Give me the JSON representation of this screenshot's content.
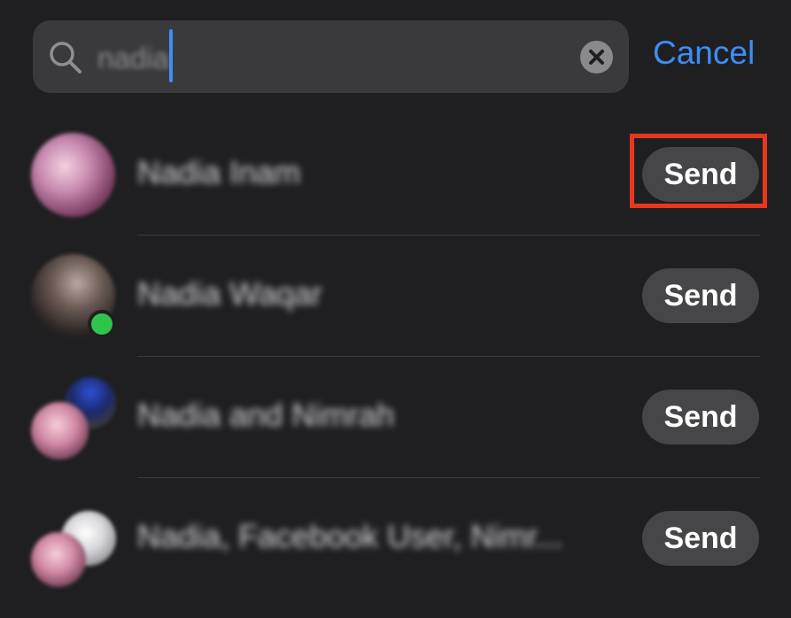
{
  "search": {
    "query": "nadia",
    "cancel_label": "Cancel"
  },
  "contacts": [
    {
      "name": "Nadia Inam",
      "send_label": "Send",
      "online": false
    },
    {
      "name": "Nadia Waqar",
      "send_label": "Send",
      "online": true
    },
    {
      "name": "Nadia and Nimrah",
      "send_label": "Send",
      "online": false
    },
    {
      "name": "Nadia, Facebook User, Nimr...",
      "send_label": "Send",
      "online": false
    }
  ],
  "colors": {
    "background": "#1f1f21",
    "search_field": "#3a3a3c",
    "accent_blue": "#3d8ef5",
    "send_button": "#464648",
    "highlight": "#e8371d",
    "online": "#31c44b"
  },
  "icons": {
    "search": "search-icon",
    "clear": "clear-icon"
  }
}
